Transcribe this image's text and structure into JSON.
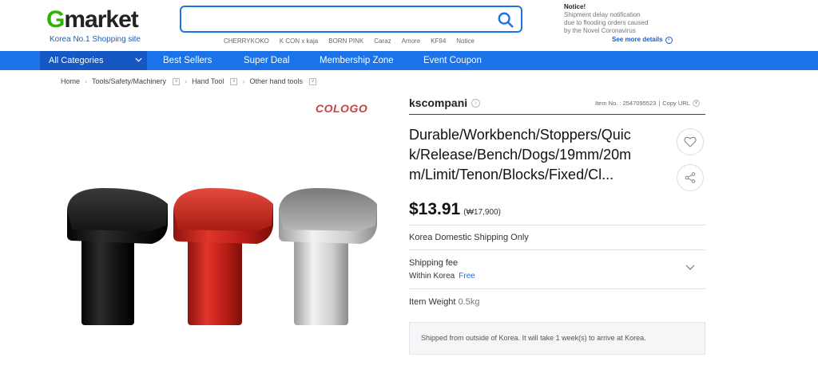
{
  "header": {
    "logo_text": "Gmarket",
    "logo_sub": "Korea No.1 Shopping site",
    "search_placeholder": "",
    "keywords": [
      "CHERRYKOKO",
      "K CON x kaja",
      "BORN PINK",
      "Caraz",
      "Amore",
      "KF94",
      "Notice"
    ],
    "notice": {
      "title": "Notice!",
      "line1": "Shipment delay notification",
      "line2": "due to flooding orders caused",
      "line3": "by the Novel Coronavirus",
      "more": "See more details"
    }
  },
  "nav": {
    "categories": "All Categories",
    "items": [
      "Best Sellers",
      "Super Deal",
      "Membership Zone",
      "Event Coupon"
    ]
  },
  "breadcrumb": [
    "Home",
    "Tools/Safety/Machinery",
    "Hand Tool",
    "Other hand tools"
  ],
  "product": {
    "brand_mark": "COLOGO",
    "seller": "kscompani",
    "item_no_label": "Item No. : 2547095523",
    "copy_url": "Copy URL",
    "title": "Durable/Workbench/Stoppers/Quick/Release/Bench/Dogs/19mm/20mm/Limit/Tenon/Blocks/Fixed/Cl...",
    "price_usd": "$13.91",
    "price_krw": "(₩17,900)",
    "shipping_region": "Korea Domestic Shipping Only",
    "shipping_fee_label": "Shipping fee",
    "shipping_within": "Within Korea",
    "shipping_fee_value": "Free",
    "weight_label": "Item Weight",
    "weight_value": "0.5kg",
    "overseas_note": "Shipped from outside of Korea. It will take 1 week(s) to arrive at Korea.",
    "image_colors": [
      "#1a1a1a",
      "#c8261e",
      "#c9c9c9"
    ]
  },
  "colors": {
    "brand_blue": "#1a73e8",
    "brand_green": "#2db400",
    "free_blue": "#1a73e8"
  }
}
